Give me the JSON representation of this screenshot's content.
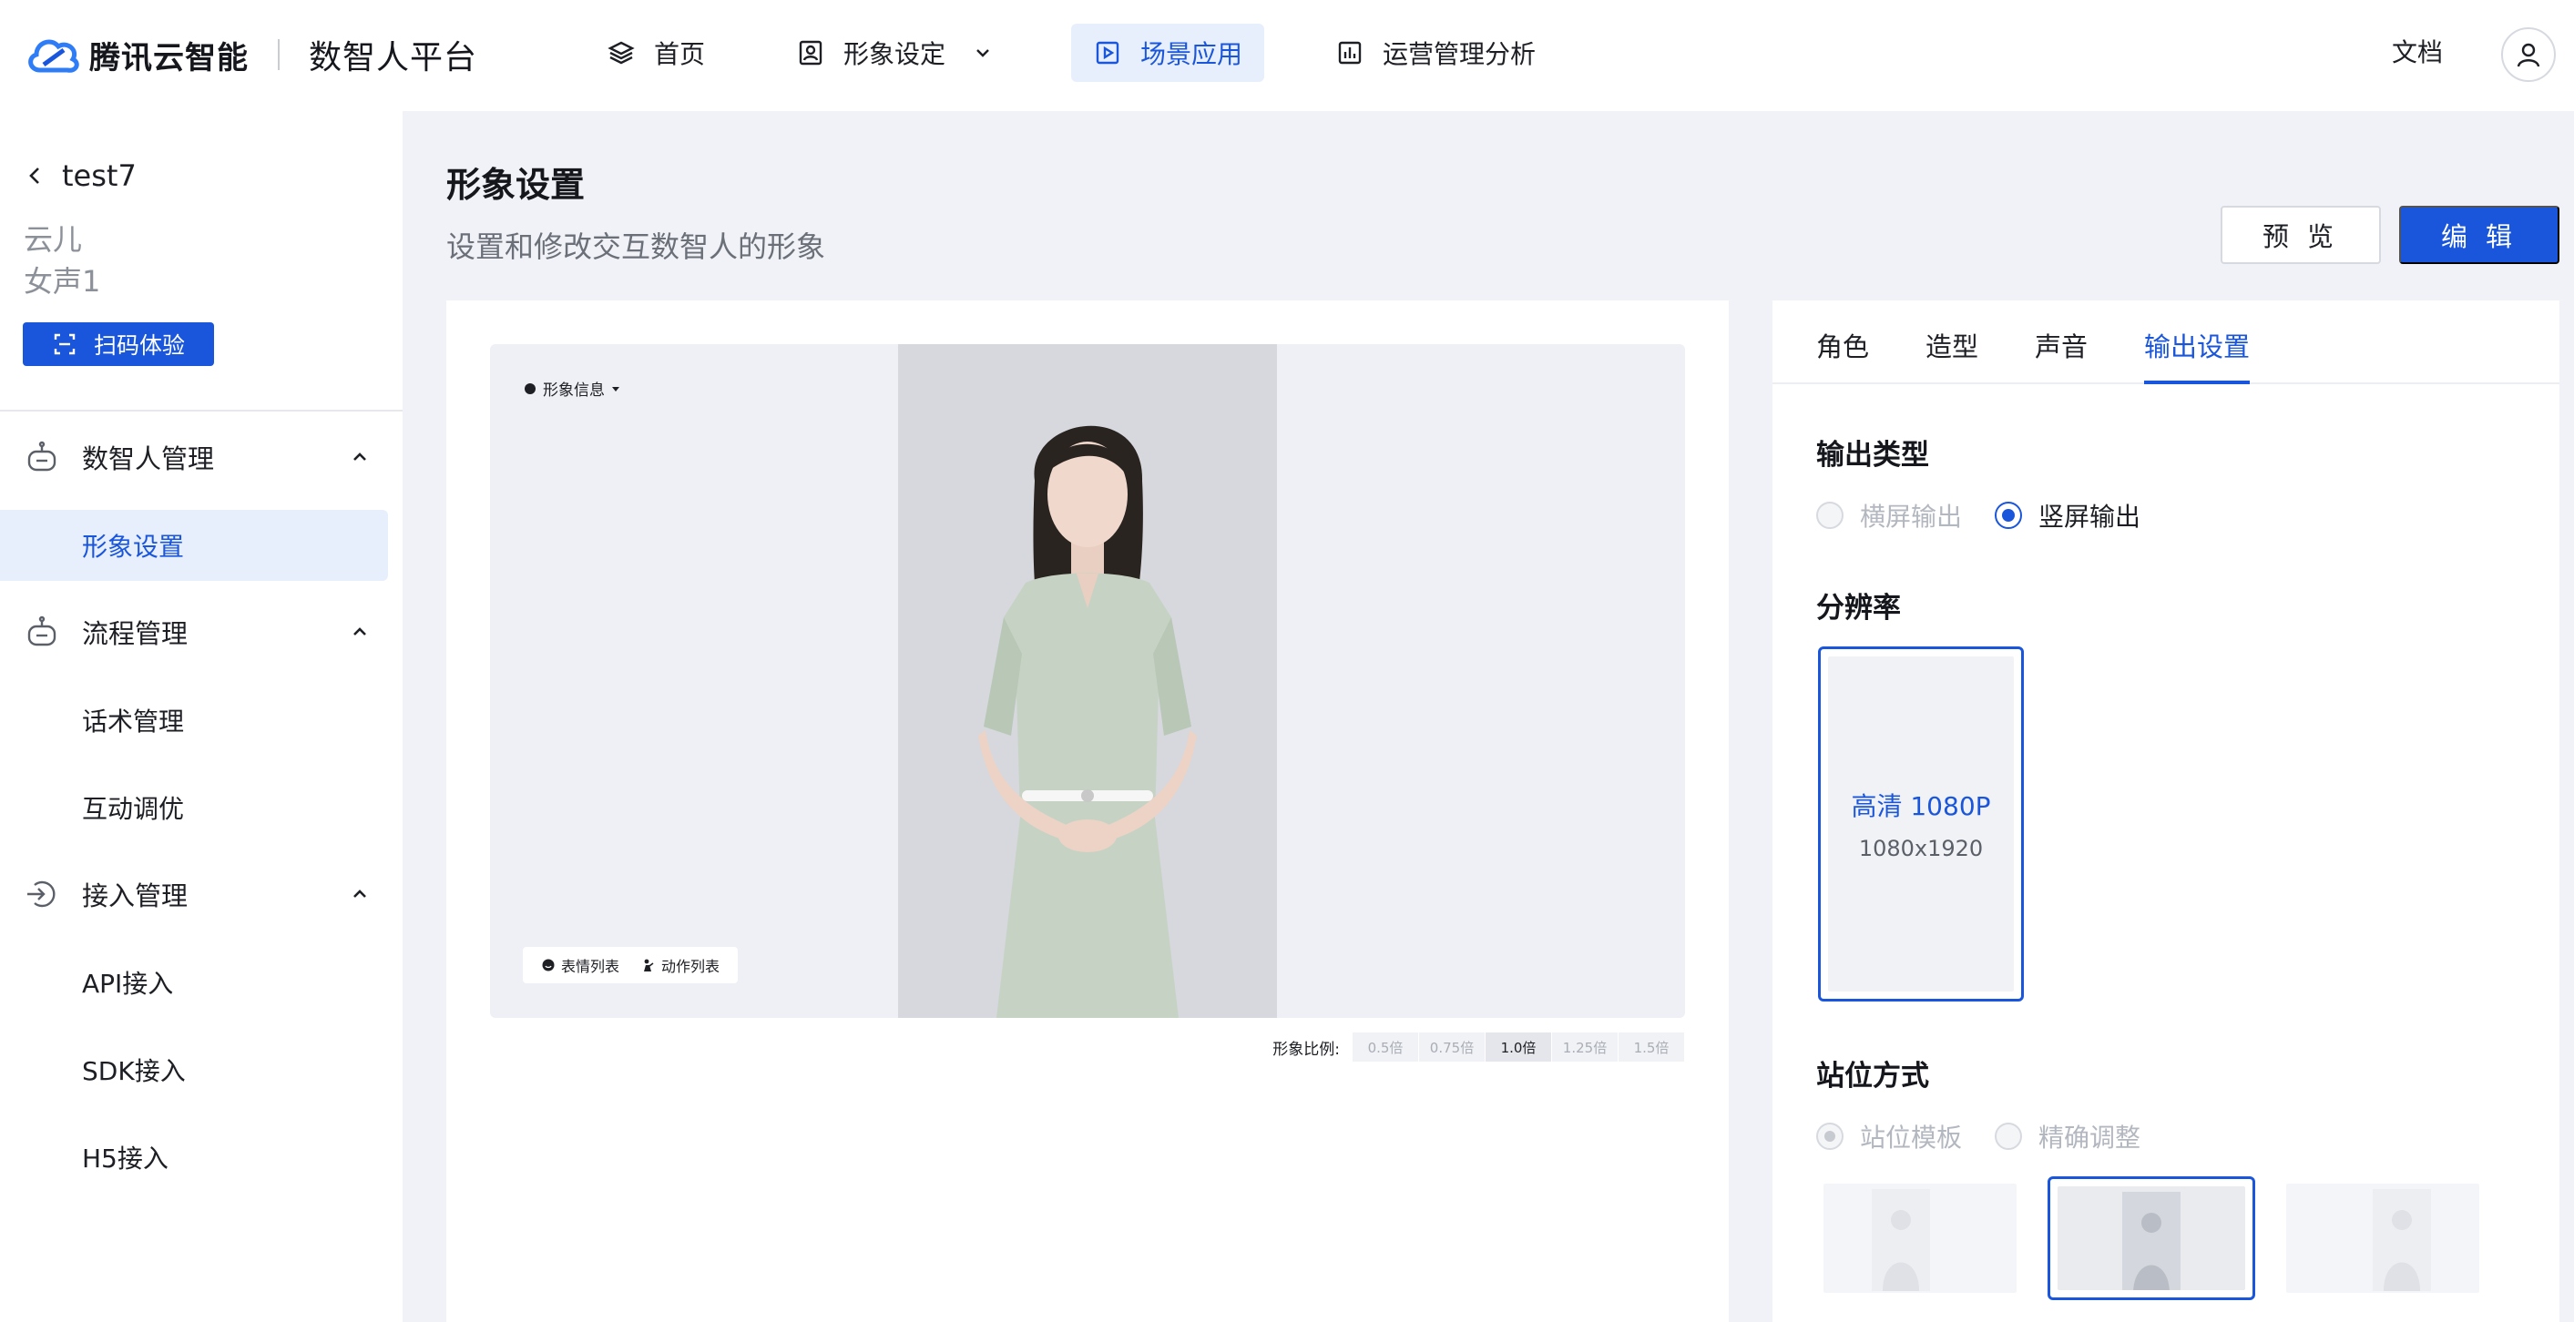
{
  "brand": {
    "company": "腾讯云智能",
    "product": "数智人平台"
  },
  "topnav": {
    "items": [
      {
        "label": "首页",
        "icon": "layers-icon"
      },
      {
        "label": "形象设定",
        "icon": "portrait-icon"
      },
      {
        "label": "场景应用",
        "icon": "play-square-icon"
      },
      {
        "label": "运营管理分析",
        "icon": "bar-chart-icon"
      }
    ],
    "docs": "文档"
  },
  "sidebar": {
    "back_label": "test7",
    "meta": [
      "云儿",
      "女声1"
    ],
    "scan_button": "扫码体验",
    "groups": [
      {
        "label": "数智人管理",
        "items": [
          "形象设置"
        ]
      },
      {
        "label": "流程管理",
        "items": [
          "话术管理",
          "互动调优"
        ]
      },
      {
        "label": "接入管理",
        "items": [
          "API接入",
          "SDK接入",
          "H5接入"
        ]
      }
    ]
  },
  "header": {
    "title": "形象设置",
    "subtitle": "设置和修改交互数智人的形象",
    "preview": "预 览",
    "edit": "编 辑"
  },
  "stage": {
    "info_dropdown": "形象信息",
    "expression_list": "表情列表",
    "action_list": "动作列表",
    "scale_label": "形象比例:",
    "scales": [
      "0.5倍",
      "0.75倍",
      "1.0倍",
      "1.25倍",
      "1.5倍"
    ],
    "scale_selected": "1.0倍"
  },
  "panel": {
    "tabs": [
      "角色",
      "造型",
      "声音",
      "输出设置"
    ],
    "active_tab": "输出设置",
    "output_type": {
      "title": "输出类型",
      "options": [
        "横屏输出",
        "竖屏输出"
      ],
      "selected": "竖屏输出"
    },
    "resolution": {
      "title": "分辨率",
      "name": "高清 1080P",
      "size": "1080x1920"
    },
    "position": {
      "title": "站位方式",
      "options": [
        "站位模板",
        "精确调整"
      ],
      "selected": "站位模板"
    }
  },
  "colors": {
    "accent": "#1a56db",
    "accent_bg": "#e8effc",
    "page_bg": "#f0f2f7"
  }
}
